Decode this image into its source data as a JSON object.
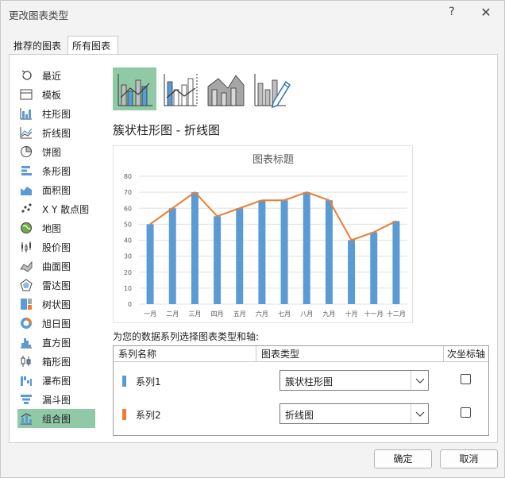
{
  "window": {
    "title": "更改图表类型",
    "help": "?",
    "close": "✕"
  },
  "tabs": [
    {
      "label": "推荐的图表",
      "active": false
    },
    {
      "label": "所有图表",
      "active": true
    }
  ],
  "sidebar": {
    "items": [
      {
        "label": "最近",
        "icon": "recent-icon",
        "active": false
      },
      {
        "label": "模板",
        "icon": "template-icon",
        "active": false
      },
      {
        "label": "柱形图",
        "icon": "column-chart-icon",
        "active": false
      },
      {
        "label": "折线图",
        "icon": "line-chart-icon",
        "active": false
      },
      {
        "label": "饼图",
        "icon": "pie-chart-icon",
        "active": false
      },
      {
        "label": "条形图",
        "icon": "bar-chart-icon",
        "active": false
      },
      {
        "label": "面积图",
        "icon": "area-chart-icon",
        "active": false
      },
      {
        "label": "X Y 散点图",
        "icon": "scatter-chart-icon",
        "active": false
      },
      {
        "label": "地图",
        "icon": "map-chart-icon",
        "active": false
      },
      {
        "label": "股价图",
        "icon": "stock-chart-icon",
        "active": false
      },
      {
        "label": "曲面图",
        "icon": "surface-chart-icon",
        "active": false
      },
      {
        "label": "雷达图",
        "icon": "radar-chart-icon",
        "active": false
      },
      {
        "label": "树状图",
        "icon": "treemap-chart-icon",
        "active": false
      },
      {
        "label": "旭日图",
        "icon": "sunburst-chart-icon",
        "active": false
      },
      {
        "label": "直方图",
        "icon": "histogram-chart-icon",
        "active": false
      },
      {
        "label": "箱形图",
        "icon": "boxplot-chart-icon",
        "active": false
      },
      {
        "label": "瀑布图",
        "icon": "waterfall-chart-icon",
        "active": false
      },
      {
        "label": "漏斗图",
        "icon": "funnel-chart-icon",
        "active": false
      },
      {
        "label": "组合图",
        "icon": "combo-chart-icon",
        "active": true
      }
    ]
  },
  "thumbnails": [
    {
      "name": "clustered-column-line",
      "selected": true
    },
    {
      "name": "clustered-column-line-secondary",
      "selected": false
    },
    {
      "name": "stacked-area-clustered-column",
      "selected": false
    },
    {
      "name": "custom-combination",
      "selected": false
    }
  ],
  "main": {
    "chart_type_title": "簇状柱形图 - 折线图",
    "series_prompt": "为您的数据系列选择图表类型和轴:"
  },
  "chart_data": {
    "type": "bar",
    "title": "图表标题",
    "categories": [
      "一月",
      "二月",
      "三月",
      "四月",
      "五月",
      "六月",
      "七月",
      "八月",
      "九月",
      "十月",
      "十一月",
      "十二月"
    ],
    "series": [
      {
        "name": "系列1",
        "type": "bar",
        "values": [
          50,
          60,
          70,
          55,
          60,
          65,
          65,
          70,
          65,
          40,
          45,
          52
        ],
        "color": "#5b9bd5"
      },
      {
        "name": "系列2",
        "type": "line",
        "values": [
          50,
          60,
          70,
          55,
          60,
          65,
          65,
          70,
          65,
          40,
          45,
          52
        ],
        "color": "#ed7d31"
      }
    ],
    "ylim": [
      0,
      80
    ],
    "yticks": [
      0,
      10,
      20,
      30,
      40,
      50,
      60,
      70,
      80
    ],
    "grid": true,
    "legend": "none"
  },
  "series_table": {
    "headers": {
      "name": "系列名称",
      "type": "图表类型",
      "secondary": "次坐标轴"
    },
    "rows": [
      {
        "name": "系列1",
        "color": "#5b9bd5",
        "chart_type": "簇状柱形图",
        "secondary": false
      },
      {
        "name": "系列2",
        "color": "#ed7d31",
        "chart_type": "折线图",
        "secondary": false
      }
    ]
  },
  "buttons": {
    "ok": "确定",
    "cancel": "取消"
  }
}
